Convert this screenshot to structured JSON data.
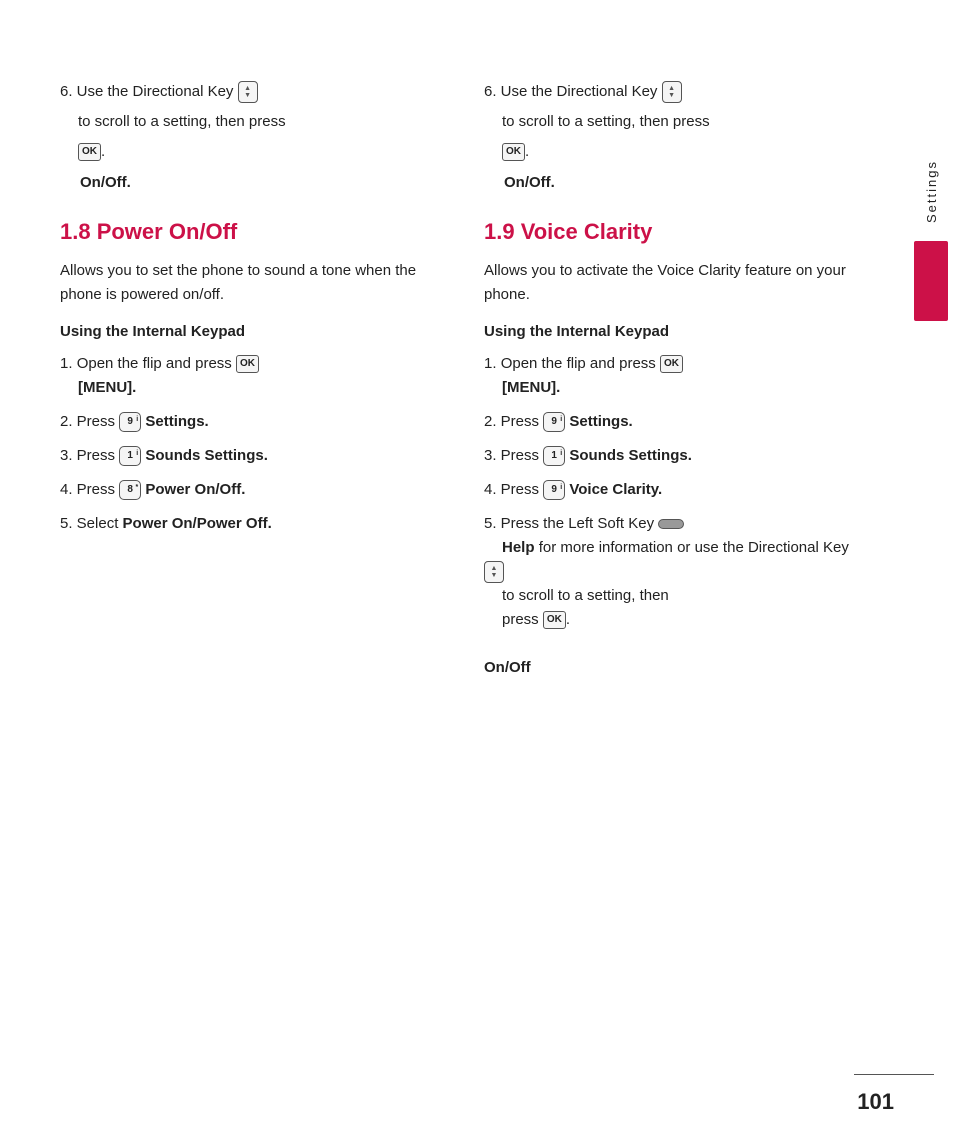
{
  "sidebar": {
    "label": "Settings",
    "accent_color": "#cc1148"
  },
  "page_number": "101",
  "left_column": {
    "intro": {
      "step6_text1": "6. Use the Directional Key",
      "step6_text2": "to scroll to a setting, then press",
      "step6_ok": "OK",
      "on_off": "On/Off."
    },
    "section_title": "1.8 Power On/Off",
    "section_desc": "Allows you to set the phone to sound a tone when the phone is powered on/off.",
    "subsection": "Using the Internal Keypad",
    "steps": [
      {
        "num": "1.",
        "text1": "Open the flip and press",
        "key": "OK",
        "text2": "[MENU]."
      },
      {
        "num": "2.",
        "text1": "Press",
        "key": "9",
        "key_sup": "i",
        "text2": "Settings."
      },
      {
        "num": "3.",
        "text1": "Press",
        "key": "1",
        "key_sup": "i",
        "text2": "Sounds Settings."
      },
      {
        "num": "4.",
        "text1": "Press",
        "key": "8",
        "key_sup": "*",
        "text2": "Power On/Off."
      },
      {
        "num": "5.",
        "text1": "Select",
        "text2": "Power On/Power Off."
      }
    ]
  },
  "right_column": {
    "intro": {
      "step6_text1": "6. Use the Directional Key",
      "step6_text2": "to scroll to a setting, then press",
      "step6_ok": "OK",
      "on_off": "On/Off."
    },
    "section_title": "1.9 Voice Clarity",
    "section_desc": "Allows you to activate the Voice Clarity feature on your phone.",
    "subsection": "Using the Internal Keypad",
    "steps": [
      {
        "num": "1.",
        "text1": "Open the flip and press",
        "key": "OK",
        "text2": "[MENU]."
      },
      {
        "num": "2.",
        "text1": "Press",
        "key": "9",
        "key_sup": "i",
        "text2": "Settings."
      },
      {
        "num": "3.",
        "text1": "Press",
        "key": "1",
        "key_sup": "i",
        "text2": "Sounds Settings."
      },
      {
        "num": "4.",
        "text1": "Press",
        "key": "9",
        "key_sup": "i",
        "text2": "Voice Clarity."
      },
      {
        "num": "5.",
        "text1": "Press the Left Soft Key",
        "text2": "Help",
        "text3": "for more information or use the Directional Key",
        "text4": "to scroll to a setting, then press",
        "text5": "OK",
        "text6": "On/Off"
      }
    ]
  }
}
